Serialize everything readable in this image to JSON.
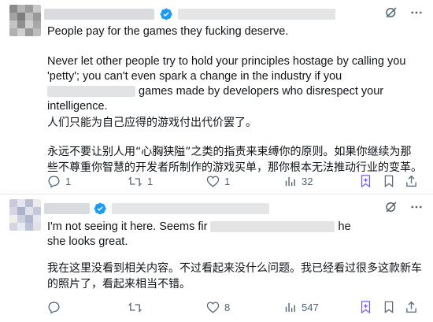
{
  "tweets": [
    {
      "en_line1": "People pay for the games they fucking deserve.",
      "en_p2_part1": "Never let other people try to hold your principles hostage by calling you 'petty'; you can't even spark a change in the industry if you",
      "en_p2_part2": "games made by developers who disrespect your intelligence.",
      "zh_line1": "人们只能为自己应得的游戏付出代价罢了。",
      "zh_p2": "永远不要让别人用“心胸狭隘”之类的指责来束缚你的原则。如果你继续为那些不尊重你智慧的开发者所制作的游戏买单，那你根本无法推动行业的变革。",
      "replies": "1",
      "retweets": "1",
      "likes": "1",
      "views": "32"
    },
    {
      "en_part1": "I'm not seeing it here. Seems fir",
      "en_part2": "he",
      "en_part3": "she looks great.",
      "zh": "我在这里没看到相关内容。不过看起来没什么问题。我已经看过很多这款新车的照片了，看起来相当不错。",
      "replies": "",
      "retweets": "",
      "likes": "8",
      "views": "547"
    }
  ],
  "colors": {
    "verified": "#1d9bf0",
    "highlight": "#7856ff",
    "icon": "#536471",
    "divider": "#e7e9ea"
  },
  "icons": [
    "verified-icon",
    "grok-icon",
    "more-icon",
    "reply-icon",
    "retweet-icon",
    "like-icon",
    "views-icon",
    "sparkle-bookmark-icon",
    "bookmark-icon",
    "share-icon"
  ]
}
